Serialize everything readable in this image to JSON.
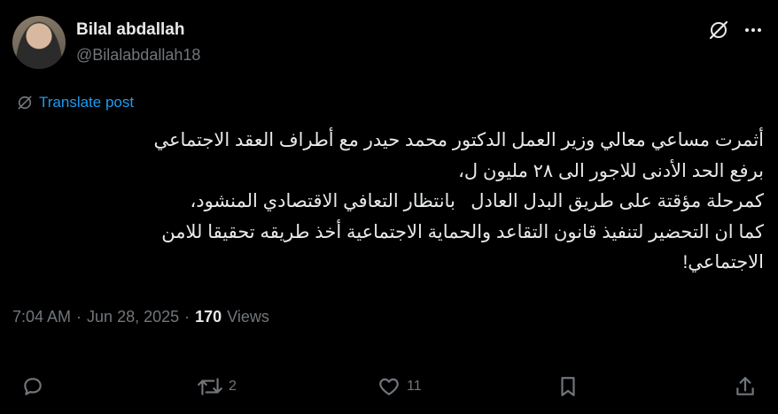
{
  "author": {
    "display_name": "Bilal abdallah",
    "handle": "@Bilalabdallah18"
  },
  "icons": {
    "grok": "grok-icon",
    "more": "more-icon",
    "translate": "translate-icon",
    "reply": "reply-icon",
    "repost": "repost-icon",
    "like": "like-icon",
    "bookmark": "bookmark-icon",
    "share": "share-icon"
  },
  "translate_label": "Translate post",
  "post_lines": [
    "أثمرت مساعي معالي وزير العمل الدكتور محمد حيدر مع أطراف العقد الاجتماعي",
    "برفع الحد الأدنى للاجور الى ٢٨ مليون ل،",
    "كمرحلة مؤقتة على طريق البدل العادل   بانتظار التعافي الاقتصادي المنشود،",
    "كما ان التحضير لتنفيذ قانون التقاعد والحماية الاجتماعية أخذ طريقه تحقيقا للامن",
    "الاجتماعي!"
  ],
  "meta": {
    "time": "7:04 AM",
    "sep1": "·",
    "date": "Jun 28, 2025",
    "sep2": "·",
    "views_count": "170",
    "views_label": "Views"
  },
  "actions": {
    "reposts": "2",
    "likes": "11"
  },
  "colors": {
    "background": "#000000",
    "text": "#e7e9ea",
    "muted": "#71767b",
    "link": "#1d9bf0"
  }
}
